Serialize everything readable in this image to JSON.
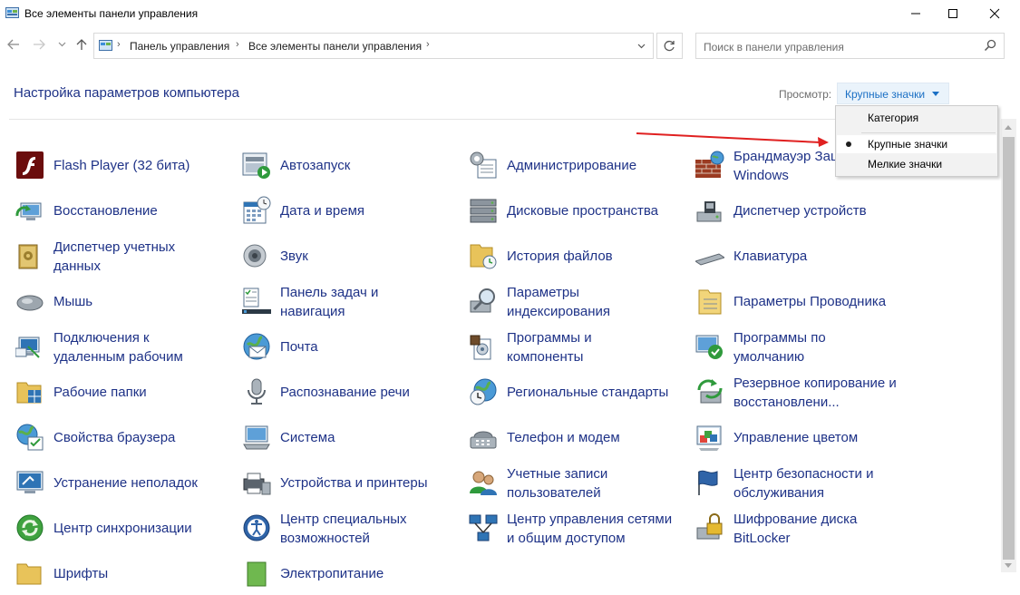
{
  "window": {
    "title": "Все элементы панели управления"
  },
  "address_bar": {
    "crumbs": [
      "Панель управления",
      "Все элементы панели управления"
    ]
  },
  "search": {
    "placeholder": "Поиск в панели управления"
  },
  "header": {
    "title": "Настройка параметров компьютера",
    "view_label": "Просмотр:",
    "view_value": "Крупные значки"
  },
  "view_menu": {
    "options": [
      "Категория",
      "Крупные значки",
      "Мелкие значки"
    ],
    "selected": "Крупные значки"
  },
  "items": [
    {
      "label": "Flash Player (32 бита)",
      "icon": "flash-player-icon"
    },
    {
      "label": "Автозапуск",
      "icon": "autoplay-icon"
    },
    {
      "label": "Администрирование",
      "icon": "administrative-tools-icon"
    },
    {
      "label": "Брандмауэр Защитника\nWindows",
      "icon": "firewall-icon"
    },
    {
      "label": "Восстановление",
      "icon": "recovery-icon"
    },
    {
      "label": "Дата и время",
      "icon": "calendar-clock-icon"
    },
    {
      "label": "Дисковые пространства",
      "icon": "storage-spaces-icon"
    },
    {
      "label": "Диспетчер устройств",
      "icon": "device-manager-icon"
    },
    {
      "label": "Диспетчер учетных\nданных",
      "icon": "credential-manager-icon"
    },
    {
      "label": "Звук",
      "icon": "speaker-icon"
    },
    {
      "label": "История файлов",
      "icon": "file-history-icon"
    },
    {
      "label": "Клавиатура",
      "icon": "keyboard-icon"
    },
    {
      "label": "Мышь",
      "icon": "mouse-icon"
    },
    {
      "label": "Панель задач и\nнавигация",
      "icon": "taskbar-icon"
    },
    {
      "label": "Параметры\nиндексирования",
      "icon": "indexing-icon"
    },
    {
      "label": "Параметры Проводника",
      "icon": "explorer-options-icon"
    },
    {
      "label": "Подключения к\nудаленным рабочим",
      "icon": "remote-desktop-icon"
    },
    {
      "label": "Почта",
      "icon": "mail-icon"
    },
    {
      "label": "Программы и\nкомпоненты",
      "icon": "programs-icon"
    },
    {
      "label": "Программы по\nумолчанию",
      "icon": "default-programs-icon"
    },
    {
      "label": "Рабочие папки",
      "icon": "work-folders-icon"
    },
    {
      "label": "Распознавание речи",
      "icon": "microphone-icon"
    },
    {
      "label": "Региональные стандарты",
      "icon": "region-clock-icon"
    },
    {
      "label": "Резервное копирование и\nвосстановлени...",
      "icon": "backup-icon"
    },
    {
      "label": "Свойства браузера",
      "icon": "internet-options-icon"
    },
    {
      "label": "Система",
      "icon": "computer-icon"
    },
    {
      "label": "Телефон и модем",
      "icon": "phone-modem-icon"
    },
    {
      "label": "Управление цветом",
      "icon": "color-management-icon"
    },
    {
      "label": "Устранение неполадок",
      "icon": "troubleshooting-icon"
    },
    {
      "label": "Устройства и принтеры",
      "icon": "printer-icon"
    },
    {
      "label": "Учетные записи\nпользователей",
      "icon": "user-accounts-icon"
    },
    {
      "label": "Центр безопасности и\nобслуживания",
      "icon": "security-flag-icon"
    },
    {
      "label": "Центр синхронизации",
      "icon": "sync-icon"
    },
    {
      "label": "Центр специальных\nвозможностей",
      "icon": "accessibility-icon"
    },
    {
      "label": "Центр управления сетями\nи общим доступом",
      "icon": "network-icon"
    },
    {
      "label": "Шифрование диска\nBitLocker",
      "icon": "bitlocker-icon"
    },
    {
      "label": "Шрифты",
      "icon": "fonts-icon"
    },
    {
      "label": "Электропитание",
      "icon": "power-icon"
    }
  ],
  "colors": {
    "link": "#1e3287",
    "accent": "#1a6fc4",
    "annotation_arrow": "#e02020"
  }
}
